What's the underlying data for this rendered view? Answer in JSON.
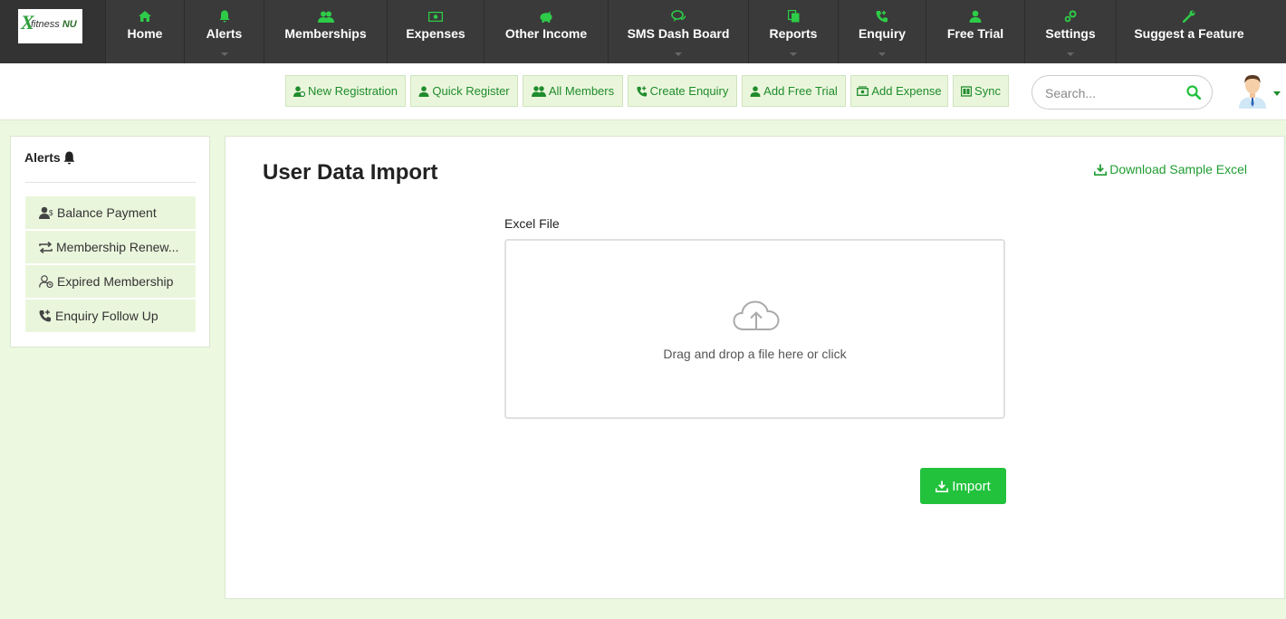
{
  "colors": {
    "accent": "#22c23c",
    "nav_bg": "#3a3a3a",
    "page_bg": "#ecf8df",
    "soft_green": "#eaf6dc"
  },
  "brand": {
    "logo_mark": "X",
    "logo_text": "fitness",
    "logo_text_bold": "NU"
  },
  "nav": {
    "items": [
      {
        "label": "Home",
        "icon": "home-icon"
      },
      {
        "label": "Alerts",
        "icon": "bell-icon"
      },
      {
        "label": "Memberships",
        "icon": "users-icon"
      },
      {
        "label": "Expenses",
        "icon": "money-icon"
      },
      {
        "label": "Other Income",
        "icon": "piggy-bank-icon"
      },
      {
        "label": "SMS Dash Board",
        "icon": "chat-icon"
      },
      {
        "label": "Reports",
        "icon": "copy-icon"
      },
      {
        "label": "Enquiry",
        "icon": "phone-icon"
      },
      {
        "label": "Free Trial",
        "icon": "user-icon"
      },
      {
        "label": "Settings",
        "icon": "gears-icon"
      },
      {
        "label": "Suggest a Feature",
        "icon": "wrench-icon"
      }
    ]
  },
  "toolbar": {
    "buttons": [
      {
        "label": "New Registration",
        "icon": "user-plus-icon"
      },
      {
        "label": "Quick Register",
        "icon": "user-icon"
      },
      {
        "label": "All Members",
        "icon": "users-icon"
      },
      {
        "label": "Create Enquiry",
        "icon": "phone-plus-icon"
      },
      {
        "label": "Add Free Trial",
        "icon": "user-icon"
      },
      {
        "label": "Add Expense",
        "icon": "money-icon"
      },
      {
        "label": "Sync",
        "icon": "sync-icon"
      }
    ],
    "search_placeholder": "Search..."
  },
  "sidebar": {
    "title": "Alerts",
    "items": [
      {
        "label": "Balance Payment",
        "icon": "user-dollar-icon"
      },
      {
        "label": "Membership Renew...",
        "icon": "refresh-icon"
      },
      {
        "label": "Expired Membership",
        "icon": "user-clock-icon"
      },
      {
        "label": "Enquiry Follow Up",
        "icon": "phone-icon"
      }
    ]
  },
  "main": {
    "title": "User Data Import",
    "download_link": "Download Sample Excel",
    "field_label": "Excel File",
    "dropzone_text": "Drag and drop a file here or click",
    "import_button": "Import"
  }
}
